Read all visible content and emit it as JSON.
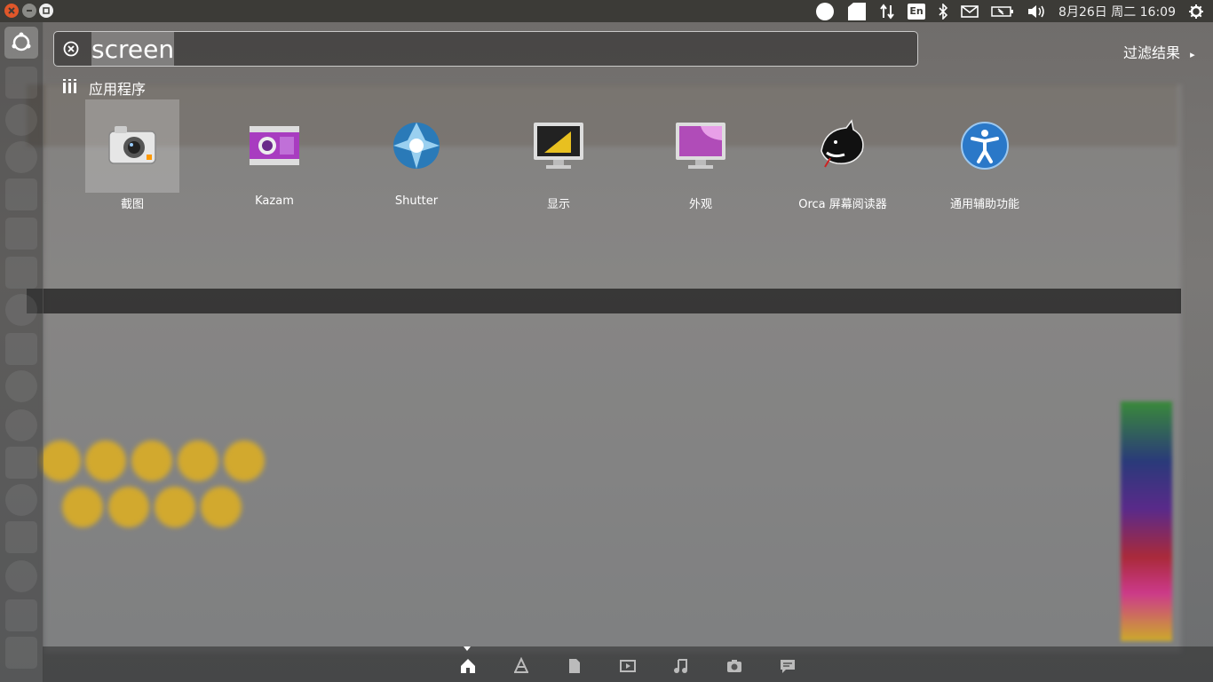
{
  "top_panel": {
    "clock": "8月26日 周二 16:09",
    "keyboard_layout": "En",
    "colors": {
      "panel": "#3c3b37",
      "close": "#e0572a"
    }
  },
  "dash": {
    "search": {
      "value": "screen",
      "placeholder": ""
    },
    "filter_label": "过滤结果",
    "category": {
      "label": "应用程序"
    },
    "apps": [
      {
        "label": "截图",
        "icon": "camera-icon"
      },
      {
        "label": "Kazam",
        "icon": "film-camera-icon"
      },
      {
        "label": "Shutter",
        "icon": "shutter-icon"
      },
      {
        "label": "显示",
        "icon": "display-icon"
      },
      {
        "label": "外观",
        "icon": "appearance-icon"
      },
      {
        "label": "Orca 屏幕阅读器",
        "icon": "orca-icon"
      },
      {
        "label": "通用辅助功能",
        "icon": "accessibility-icon"
      }
    ],
    "lenses": [
      "home-icon",
      "applications-icon",
      "files-icon",
      "video-icon",
      "music-icon",
      "photo-icon",
      "social-icon"
    ]
  }
}
